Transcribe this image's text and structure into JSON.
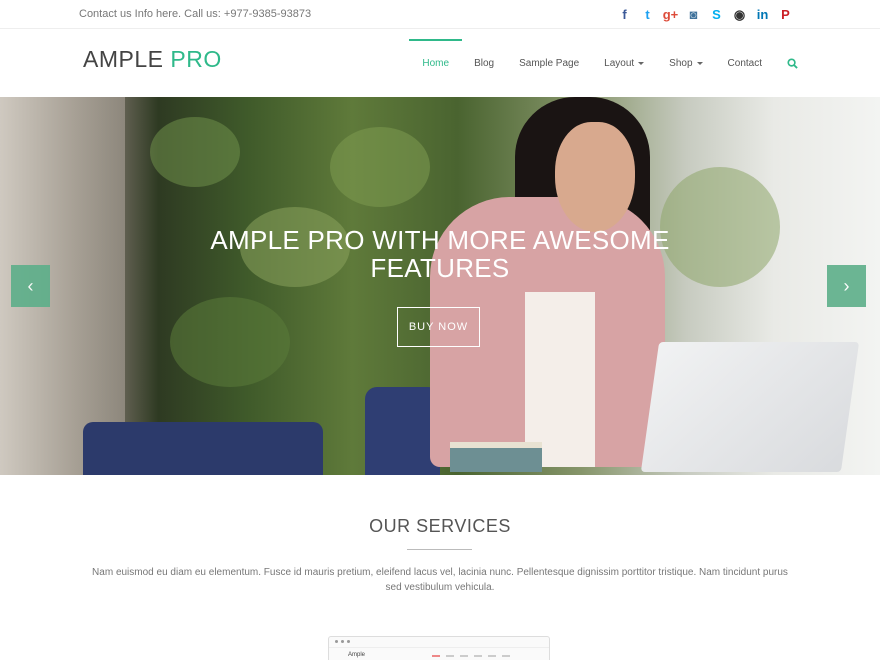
{
  "topbar": {
    "contact_text": "Contact us Info here. Call us: +977-9385-93873",
    "social_icons": [
      "facebook-icon",
      "twitter-icon",
      "google-plus-icon",
      "instagram-icon",
      "skype-icon",
      "github-icon",
      "linkedin-icon",
      "pinterest-icon"
    ],
    "social_glyphs": [
      "f",
      "t",
      "g+",
      "◙",
      "S",
      "◉",
      "in",
      "P"
    ],
    "social_colors": [
      "#3b5998",
      "#1da1f2",
      "#dd4b39",
      "#3f729b",
      "#00aff0",
      "#333333",
      "#0077b5",
      "#cb2027"
    ]
  },
  "header": {
    "logo_main": "AMPLE ",
    "logo_accent": "PRO",
    "accent_color": "#2fb98a",
    "nav": [
      {
        "label": "Home",
        "active": true
      },
      {
        "label": "Blog"
      },
      {
        "label": "Sample Page"
      },
      {
        "label": "Layout",
        "dropdown": true
      },
      {
        "label": "Shop",
        "dropdown": true
      },
      {
        "label": "Contact"
      }
    ]
  },
  "hero": {
    "title_line1": "AMPLE PRO WITH MORE AWESOME",
    "title_line2": "FEATURES",
    "button_label": "BUY NOW",
    "prev_glyph": "‹",
    "next_glyph": "›"
  },
  "services": {
    "title": "OUR SERVICES",
    "text": "Nam euismod eu diam eu elementum. Fusce id mauris pretium, eleifend lacus vel, lacinia nunc. Pellentesque dignissim porttitor tristique. Nam tincidunt purus sed vestibulum vehicula."
  },
  "preview": {
    "label": "Ample"
  }
}
